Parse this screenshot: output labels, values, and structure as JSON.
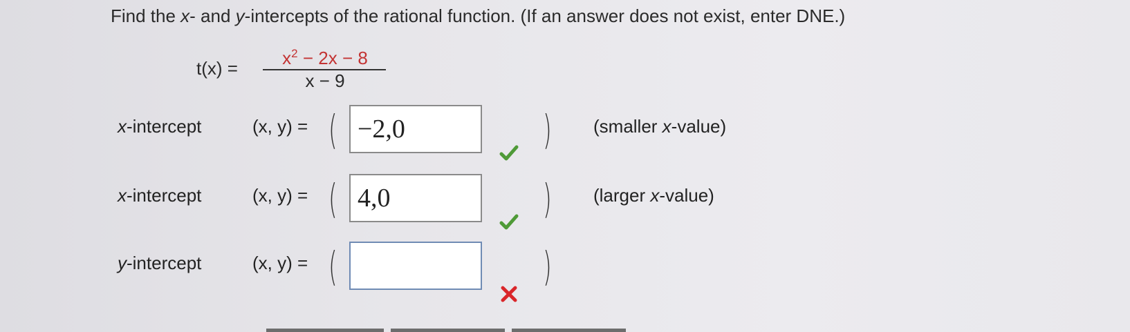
{
  "question": {
    "prefix": "Find the ",
    "x_var": "x",
    "middle": "- and ",
    "y_var": "y",
    "suffix": "-intercepts of the rational function. (If an answer does not exist, enter DNE.)"
  },
  "function": {
    "lhs": "t(x) =",
    "numerator_base": "x",
    "numerator_exp": "2",
    "numerator_rest": " − 2x − 8",
    "denominator": "x − 9"
  },
  "rows": [
    {
      "label_var": "x",
      "label_rest": "-intercept",
      "xy": "(x, y) =",
      "value": "−2,0",
      "status": "correct",
      "hint_open": "(smaller ",
      "hint_var": "x",
      "hint_close": "-value)"
    },
    {
      "label_var": "x",
      "label_rest": "-intercept",
      "xy": "(x, y) =",
      "value": "4,0",
      "status": "correct",
      "hint_open": "(larger ",
      "hint_var": "x",
      "hint_close": "-value)"
    },
    {
      "label_var": "y",
      "label_rest": "-intercept",
      "xy": "(x, y) =",
      "value": "",
      "status": "incorrect"
    }
  ],
  "colors": {
    "correct": "#4e9a37",
    "incorrect": "#d9262a",
    "numerator": "#c33333"
  }
}
